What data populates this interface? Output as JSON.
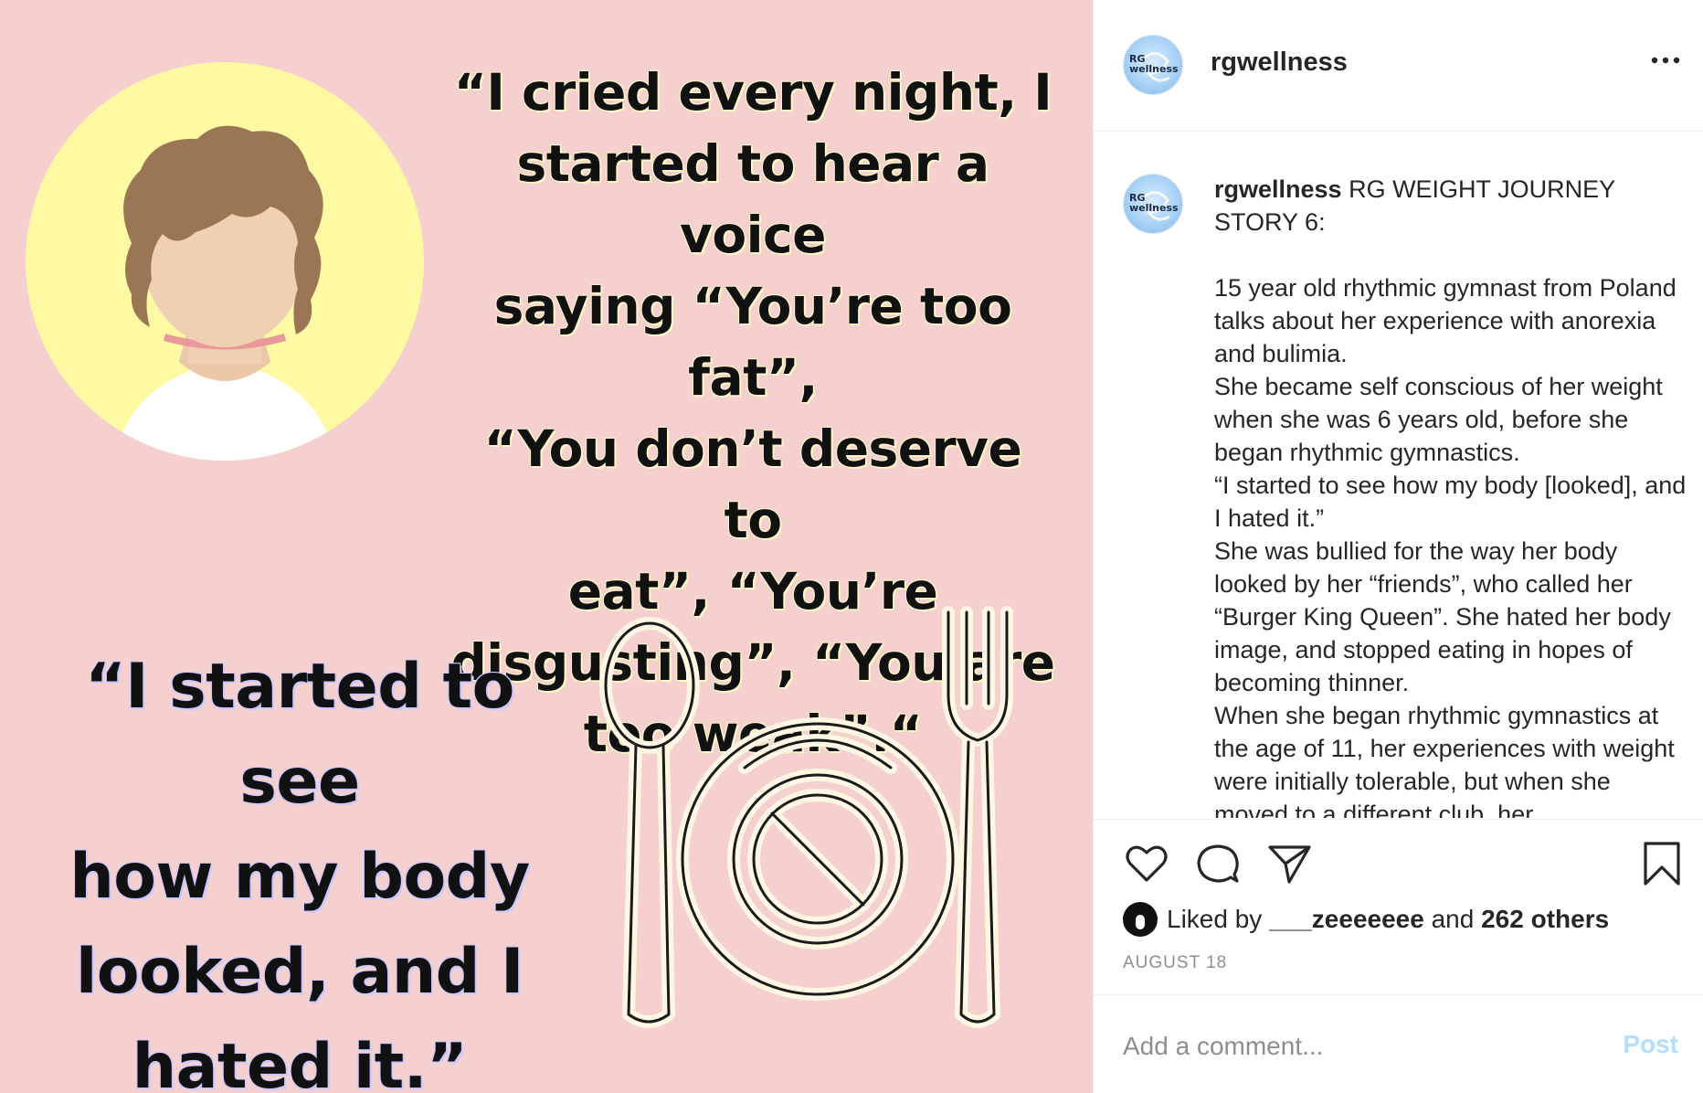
{
  "post": {
    "image": {
      "quote_top": "“I cried every night, I\nstarted to hear a voice\nsaying “You’re too fat”,\n“You don’t deserve to\neat”, “You’re\ndisgusting”, “You are\ntoo weak”.“",
      "quote_bottom": "“I started to see\nhow my body\nlooked, and I\nhated it.”",
      "colors": {
        "background": "#f6cfcf",
        "circle": "#fdfaa3",
        "hair": "#9b7654",
        "skin": "#f0d0b3"
      }
    },
    "header": {
      "username": "rgwellness",
      "avatar_logo_line1": "RG",
      "avatar_logo_line2": "wellness"
    },
    "caption": {
      "username": "rgwellness",
      "title": " RG WEIGHT JOURNEY STORY 6:",
      "body": "15 year old rhythmic gymnast from Poland talks about her experience with anorexia and bulimia.\nShe became self conscious of her weight when she was 6 years old, before she began rhythmic gymnastics.\n“I started to see how my body [looked], and I hated it.”\nShe was bullied for the way her body looked by her “friends”, who called her “Burger King Queen”. She hated her body image, and stopped eating in hopes of becoming thinner.\nWhen she began rhythmic gymnastics at the age of 11, her experiences with weight were initially tolerable, but when she moved to a different club, her"
    },
    "likes": {
      "prefix": "Liked by ",
      "user": "___zeeeeeee",
      "middle": " and ",
      "others": "262 others"
    },
    "date": "AUGUST 18",
    "comment": {
      "placeholder": "Add a comment...",
      "post_label": "Post"
    },
    "icons": {
      "more": "more-options-icon",
      "like": "heart-icon",
      "comment": "comment-bubble-icon",
      "share": "paper-plane-icon",
      "save": "bookmark-icon"
    }
  }
}
